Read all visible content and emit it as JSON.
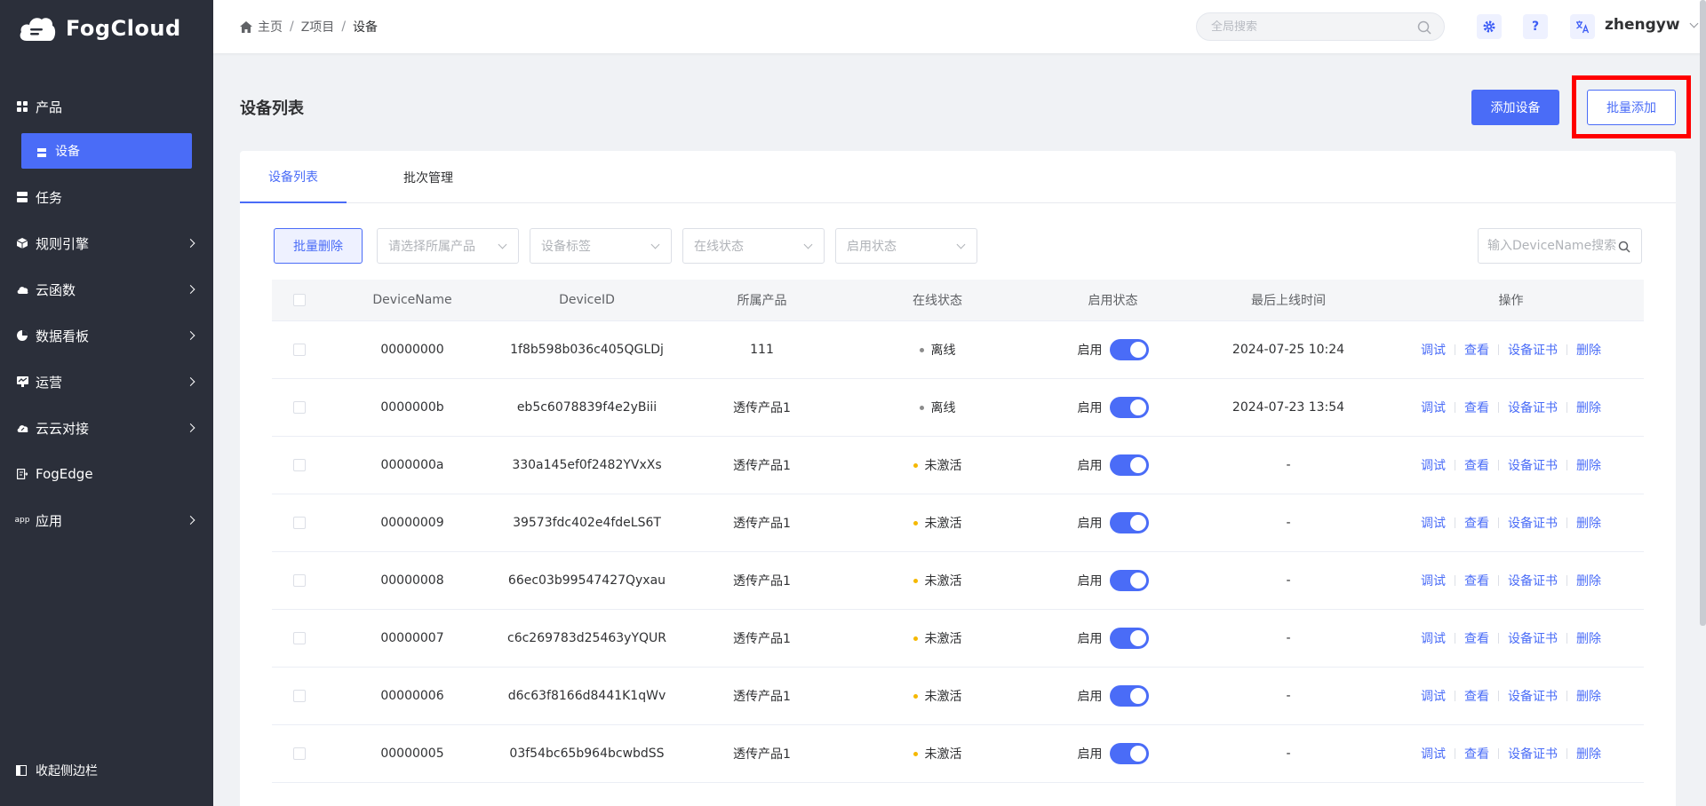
{
  "app": {
    "name": "FogCloud"
  },
  "sidebar": {
    "items": [
      {
        "label": "产品",
        "icon": "grid-icon",
        "expandable": false
      },
      {
        "label": "设备",
        "icon": "device-icon",
        "active": true,
        "sub": true
      },
      {
        "label": "任务",
        "icon": "task-icon",
        "expandable": false
      },
      {
        "label": "规则引擎",
        "icon": "cube-icon",
        "expandable": true
      },
      {
        "label": "云函数",
        "icon": "cloud-icon",
        "expandable": true
      },
      {
        "label": "数据看板",
        "icon": "pie-icon",
        "expandable": true
      },
      {
        "label": "运营",
        "icon": "chart-icon",
        "expandable": true
      },
      {
        "label": "云云对接",
        "icon": "cloud-link-icon",
        "expandable": true
      },
      {
        "label": "FogEdge",
        "icon": "edge-icon",
        "expandable": false
      },
      {
        "label": "应用",
        "icon": "app-icon",
        "expandable": true
      }
    ],
    "collapse_label": "收起侧边栏",
    "app_icon_text": "app"
  },
  "header": {
    "breadcrumb": [
      "主页",
      "Z项目",
      "设备"
    ],
    "separator": "/",
    "search_placeholder": "全局搜索",
    "help_label": "?",
    "username": "zhengyw"
  },
  "page": {
    "title": "设备列表",
    "add_device_label": "添加设备",
    "batch_add_label": "批量添加"
  },
  "tabs": [
    "设备列表",
    "批次管理"
  ],
  "filters": {
    "batch_delete_label": "批量删除",
    "product_placeholder": "请选择所属产品",
    "tag_placeholder": "设备标签",
    "online_placeholder": "在线状态",
    "enable_placeholder": "启用状态",
    "search_placeholder": "输入DeviceName搜索"
  },
  "table": {
    "columns": [
      "DeviceName",
      "DeviceID",
      "所属产品",
      "在线状态",
      "启用状态",
      "最后上线时间",
      "操作"
    ],
    "actions": [
      "调试",
      "查看",
      "设备证书",
      "删除"
    ],
    "enable_label": "启用",
    "rows": [
      {
        "name": "00000000",
        "id": "1f8b598b036c405QGLDj",
        "product": "111",
        "status": "离线",
        "status_type": "offline",
        "enabled": "启用",
        "last_online": "2024-07-25 10:24"
      },
      {
        "name": "0000000b",
        "id": "eb5c6078839f4e2yBiii",
        "product": "透传产品1",
        "status": "离线",
        "status_type": "offline",
        "enabled": "启用",
        "last_online": "2024-07-23 13:54"
      },
      {
        "name": "0000000a",
        "id": "330a145ef0f2482YVxXs",
        "product": "透传产品1",
        "status": "未激活",
        "status_type": "inactive",
        "enabled": "启用",
        "last_online": "-"
      },
      {
        "name": "00000009",
        "id": "39573fdc402e4fdeLS6T",
        "product": "透传产品1",
        "status": "未激活",
        "status_type": "inactive",
        "enabled": "启用",
        "last_online": "-"
      },
      {
        "name": "00000008",
        "id": "66ec03b99547427Qyxau",
        "product": "透传产品1",
        "status": "未激活",
        "status_type": "inactive",
        "enabled": "启用",
        "last_online": "-"
      },
      {
        "name": "00000007",
        "id": "c6c269783d25463yYQUR",
        "product": "透传产品1",
        "status": "未激活",
        "status_type": "inactive",
        "enabled": "启用",
        "last_online": "-"
      },
      {
        "name": "00000006",
        "id": "d6c63f8166d8441K1qWv",
        "product": "透传产品1",
        "status": "未激活",
        "status_type": "inactive",
        "enabled": "启用",
        "last_online": "-"
      },
      {
        "name": "00000005",
        "id": "03f54bc65b964bcwbdSS",
        "product": "透传产品1",
        "status": "未激活",
        "status_type": "inactive",
        "enabled": "启用",
        "last_online": "-"
      }
    ]
  },
  "colors": {
    "primary": "#4a6cf7",
    "sidebar_bg": "#2b2f3a",
    "highlight": "#ff0000",
    "offline_dot": "#8c8c8c",
    "inactive_dot": "#f5b800"
  }
}
